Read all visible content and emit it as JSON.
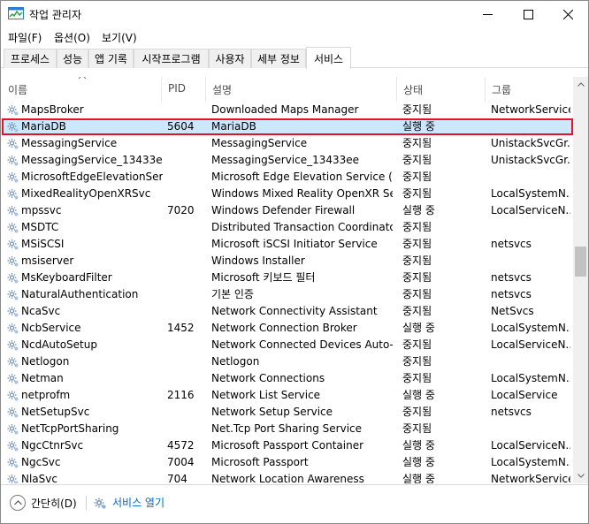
{
  "window": {
    "title": "작업 관리자"
  },
  "menu": [
    "파일(F)",
    "옵션(O)",
    "보기(V)"
  ],
  "tabs": [
    "프로세스",
    "성능",
    "앱 기록",
    "시작프로그램",
    "사용자",
    "세부 정보",
    "서비스"
  ],
  "active_tab_index": 6,
  "columns": [
    "이름",
    "PID",
    "설명",
    "상태",
    "그룹"
  ],
  "rows": [
    {
      "name": "MapsBroker",
      "pid": "",
      "desc": "Downloaded Maps Manager",
      "status": "중지됨",
      "group": "NetworkService"
    },
    {
      "name": "MariaDB",
      "pid": "5604",
      "desc": "MariaDB",
      "status": "실행 중",
      "group": ""
    },
    {
      "name": "MessagingService",
      "pid": "",
      "desc": "MessagingService",
      "status": "중지됨",
      "group": "UnistackSvcGr..."
    },
    {
      "name": "MessagingService_13433ee",
      "pid": "",
      "desc": "MessagingService_13433ee",
      "status": "중지됨",
      "group": "UnistackSvcGr..."
    },
    {
      "name": "MicrosoftEdgeElevationSer...",
      "pid": "",
      "desc": "Microsoft Edge Elevation Service (...",
      "status": "중지됨",
      "group": ""
    },
    {
      "name": "MixedRealityOpenXRSvc",
      "pid": "",
      "desc": "Windows Mixed Reality OpenXR Ser...",
      "status": "중지됨",
      "group": "LocalSystemN..."
    },
    {
      "name": "mpssvc",
      "pid": "7020",
      "desc": "Windows Defender Firewall",
      "status": "실행 중",
      "group": "LocalServiceN..."
    },
    {
      "name": "MSDTC",
      "pid": "",
      "desc": "Distributed Transaction Coordinator",
      "status": "중지됨",
      "group": ""
    },
    {
      "name": "MSiSCSI",
      "pid": "",
      "desc": "Microsoft iSCSI Initiator Service",
      "status": "중지됨",
      "group": "netsvcs"
    },
    {
      "name": "msiserver",
      "pid": "",
      "desc": "Windows Installer",
      "status": "중지됨",
      "group": ""
    },
    {
      "name": "MsKeyboardFilter",
      "pid": "",
      "desc": "Microsoft 키보드 필터",
      "status": "중지됨",
      "group": "netsvcs"
    },
    {
      "name": "NaturalAuthentication",
      "pid": "",
      "desc": "기본 인증",
      "status": "중지됨",
      "group": "netsvcs"
    },
    {
      "name": "NcaSvc",
      "pid": "",
      "desc": "Network Connectivity Assistant",
      "status": "중지됨",
      "group": "NetSvcs"
    },
    {
      "name": "NcbService",
      "pid": "1452",
      "desc": "Network Connection Broker",
      "status": "실행 중",
      "group": "LocalSystemN..."
    },
    {
      "name": "NcdAutoSetup",
      "pid": "",
      "desc": "Network Connected Devices Auto-...",
      "status": "중지됨",
      "group": "LocalServiceN..."
    },
    {
      "name": "Netlogon",
      "pid": "",
      "desc": "Netlogon",
      "status": "중지됨",
      "group": ""
    },
    {
      "name": "Netman",
      "pid": "",
      "desc": "Network Connections",
      "status": "중지됨",
      "group": "LocalSystemN..."
    },
    {
      "name": "netprofm",
      "pid": "2116",
      "desc": "Network List Service",
      "status": "실행 중",
      "group": "LocalService"
    },
    {
      "name": "NetSetupSvc",
      "pid": "",
      "desc": "Network Setup Service",
      "status": "중지됨",
      "group": "netsvcs"
    },
    {
      "name": "NetTcpPortSharing",
      "pid": "",
      "desc": "Net.Tcp Port Sharing Service",
      "status": "중지됨",
      "group": ""
    },
    {
      "name": "NgcCtnrSvc",
      "pid": "4572",
      "desc": "Microsoft Passport Container",
      "status": "실행 중",
      "group": "LocalServiceN..."
    },
    {
      "name": "NgcSvc",
      "pid": "7004",
      "desc": "Microsoft Passport",
      "status": "실행 중",
      "group": "LocalSystemN..."
    },
    {
      "name": "NlaSvc",
      "pid": "704",
      "desc": "Network Location Awareness",
      "status": "실행 중",
      "group": "NetworkService"
    }
  ],
  "selected_row_index": 1,
  "footer": {
    "collapse_label": "간단히(D)",
    "open_services_label": "서비스 열기"
  },
  "colors": {
    "selection": "#cce8ff",
    "highlight_border": "#e81123",
    "link": "#0066cc"
  }
}
